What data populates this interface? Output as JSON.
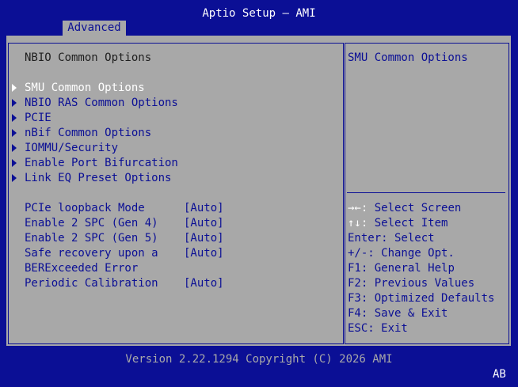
{
  "window": {
    "title": "Aptio Setup – AMI",
    "active_tab": "Advanced"
  },
  "main": {
    "heading": "NBIO Common Options",
    "submenus": [
      {
        "label": "SMU Common Options",
        "selected": true
      },
      {
        "label": "NBIO RAS Common Options",
        "selected": false
      },
      {
        "label": "PCIE",
        "selected": false
      },
      {
        "label": "nBif Common Options",
        "selected": false
      },
      {
        "label": "IOMMU/Security",
        "selected": false
      },
      {
        "label": "Enable Port Bifurcation",
        "selected": false
      },
      {
        "label": "Link EQ Preset Options",
        "selected": false
      }
    ],
    "options": [
      {
        "label": "PCIe loopback Mode",
        "value": "[Auto]"
      },
      {
        "label": "Enable 2 SPC (Gen 4)",
        "value": "[Auto]"
      },
      {
        "label": "Enable 2 SPC (Gen 5)",
        "value": "[Auto]"
      },
      {
        "label": "Safe recovery upon a",
        "value": "[Auto]"
      },
      {
        "label": "BERExceeded Error",
        "value": ""
      },
      {
        "label": "Periodic Calibration",
        "value": "[Auto]"
      }
    ]
  },
  "help": {
    "description": "SMU Common Options",
    "keys": [
      {
        "key": "→←:",
        "action": " Select Screen"
      },
      {
        "key": "↑↓:",
        "action": " Select Item"
      },
      {
        "key": "Enter:",
        "action": " Select"
      },
      {
        "key": "+/-:",
        "action": " Change Opt."
      },
      {
        "key": "F1:",
        "action": " General Help"
      },
      {
        "key": "F2:",
        "action": " Previous Values"
      },
      {
        "key": "F3:",
        "action": " Optimized Defaults"
      },
      {
        "key": "F4:",
        "action": " Save & Exit"
      },
      {
        "key": "ESC:",
        "action": " Exit"
      }
    ]
  },
  "footer": {
    "version": "Version 2.22.1294 Copyright (C) 2026 AMI",
    "corner_badge": "AB"
  },
  "colors": {
    "background": "#0b0f95",
    "panel": "#a8a8a8",
    "selected_text": "#ffffff",
    "menu_text": "#0b0f95"
  }
}
